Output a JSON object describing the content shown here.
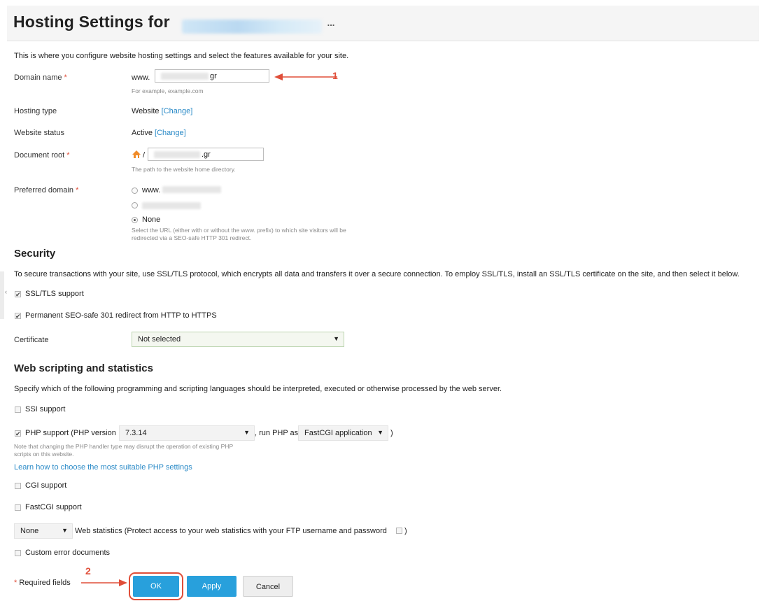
{
  "header": {
    "title": "Hosting Settings for",
    "more_label": "..."
  },
  "intro": "This is where you configure website hosting settings and select the features available for your site.",
  "domain": {
    "label": "Domain name",
    "required_mark": "*",
    "prefix": "www.",
    "value_suffix": "gr",
    "hint": "For example, example.com"
  },
  "hosting_type": {
    "label": "Hosting type",
    "value": "Website",
    "change": "[Change]"
  },
  "website_status": {
    "label": "Website status",
    "value": "Active",
    "change": "[Change]"
  },
  "document_root": {
    "label": "Document root",
    "required_mark": "*",
    "prefix": "/",
    "value_suffix": ".gr",
    "hint": "The path to the website home directory."
  },
  "preferred_domain": {
    "label": "Preferred domain",
    "required_mark": "*",
    "option_www": "www.",
    "option_none": "None",
    "hint_line1": "Select the URL (either with or without the www. prefix) to which site visitors will be",
    "hint_line2": "redirected via a SEO-safe HTTP 301 redirect."
  },
  "security": {
    "title": "Security",
    "description": "To secure transactions with your site, use SSL/TLS protocol, which encrypts all data and transfers it over a secure connection. To employ SSL/TLS, install an SSL/TLS certificate on the site, and then select it below.",
    "ssl_label": "SSL/TLS support",
    "redirect_label": "Permanent SEO-safe 301 redirect from HTTP to HTTPS",
    "certificate_label": "Certificate",
    "certificate_value": "Not selected"
  },
  "scripting": {
    "title": "Web scripting and statistics",
    "description": "Specify which of the following programming and scripting languages should be interpreted, executed or otherwise processed by the web server.",
    "ssi_label": "SSI support",
    "php_label": "PHP support (PHP version",
    "php_version": "7.3.14",
    "run_as_label": ", run PHP as",
    "php_handler": "FastCGI application",
    "close_paren": ")",
    "php_note_line1": "Note that changing the PHP handler type may disrupt the operation of existing PHP",
    "php_note_line2": "scripts on this website.",
    "php_learn_link": "Learn how to choose the most suitable PHP settings",
    "cgi_label": "CGI support",
    "fastcgi_label": "FastCGI support",
    "stats_value": "None",
    "stats_label": "Web statistics (Protect access to your web statistics with your FTP username and password",
    "stats_close": ")",
    "custom_errors_label": "Custom error documents"
  },
  "footer": {
    "required_mark": "*",
    "required_text": "Required fields",
    "ok": "OK",
    "apply": "Apply",
    "cancel": "Cancel"
  },
  "annotations": {
    "one": "1",
    "two": "2"
  },
  "colors": {
    "accent": "#28a0dc",
    "link": "#2a8ac7",
    "required": "#e04e39",
    "annotation": "#e04e39"
  }
}
